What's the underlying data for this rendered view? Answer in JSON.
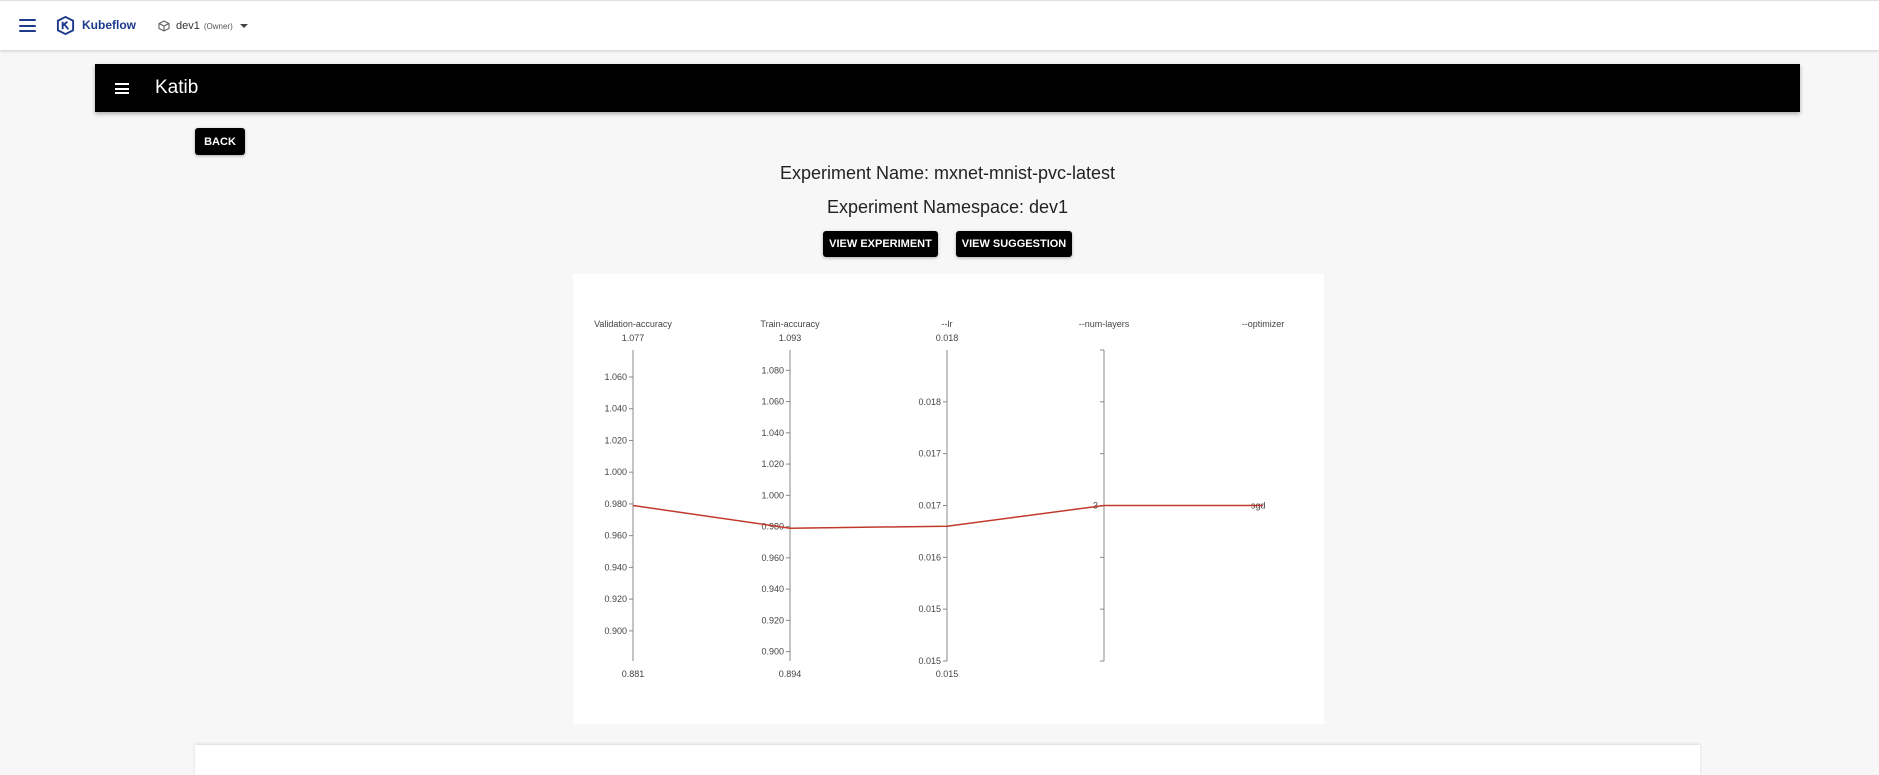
{
  "app": {
    "title": "Kubeflow"
  },
  "namespace": {
    "name": "dev1",
    "role": "(Owner)"
  },
  "katib": {
    "title": "Katib"
  },
  "buttons": {
    "back": "BACK",
    "view_experiment": "VIEW EXPERIMENT",
    "view_suggestion": "VIEW SUGGESTION"
  },
  "experiment": {
    "name_line": "Experiment Name: mxnet-mnist-pvc-latest",
    "namespace_line": "Experiment Namespace: dev1"
  },
  "icons": {
    "menu": "hamburger-icon",
    "logo": "kubeflow-logo-icon",
    "namespace": "cube-icon",
    "dropdown": "caret-down-icon"
  },
  "colors": {
    "line": "#c0392b",
    "primary": "#1e3a8a",
    "button": "#000000"
  },
  "chart_data": {
    "type": "parallel_coordinates",
    "dimensions": [
      {
        "label": "Validation-accuracy",
        "range": [
          0.881,
          1.077
        ],
        "range_labels": [
          "0.881",
          "1.077"
        ],
        "ticks": [
          0.9,
          0.92,
          0.94,
          0.96,
          0.98,
          1.0,
          1.02,
          1.04,
          1.06
        ],
        "tick_labels": [
          "0.900",
          "0.920",
          "0.940",
          "0.960",
          "0.980",
          "1.000",
          "1.020",
          "1.040",
          "1.060"
        ]
      },
      {
        "label": "Train-accuracy",
        "range": [
          0.894,
          1.093
        ],
        "range_labels": [
          "0.894",
          "1.093"
        ],
        "ticks": [
          0.9,
          0.92,
          0.94,
          0.96,
          0.98,
          1.0,
          1.02,
          1.04,
          1.06,
          1.08
        ],
        "tick_labels": [
          "0.900",
          "0.920",
          "0.940",
          "0.960",
          "0.980",
          "1.000",
          "1.020",
          "1.040",
          "1.060",
          "1.080"
        ]
      },
      {
        "label": "--lr",
        "range": [
          0.015,
          0.018
        ],
        "range_labels": [
          "0.015",
          "0.018"
        ],
        "ticks": [
          0.015,
          0.0155,
          0.016,
          0.0165,
          0.017,
          0.0175
        ],
        "tick_labels": [
          "0.015",
          "0.015",
          "0.016",
          "0.017",
          "0.017",
          "0.018"
        ]
      },
      {
        "label": "--num-layers",
        "range": [
          0,
          6
        ],
        "ticks": [
          0,
          1,
          2,
          3,
          4,
          5,
          6
        ],
        "tick_labels": [
          "",
          "",
          "",
          "3",
          "",
          "",
          ""
        ]
      },
      {
        "label": "--optimizer",
        "categorical": true,
        "categories": [
          "sgd"
        ]
      }
    ],
    "lines": [
      {
        "values": [
          0.979,
          0.979,
          0.0163,
          3,
          "sgd"
        ]
      }
    ]
  }
}
